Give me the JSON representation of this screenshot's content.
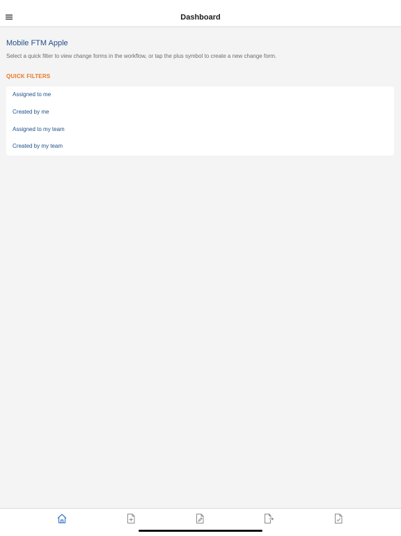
{
  "header": {
    "title": "Dashboard",
    "menu_icon": "hamburger-menu-icon"
  },
  "main": {
    "app_title": "Mobile FTM Apple",
    "subtitle": "Select a quick filter to view change forms in the workflow, or tap the plus symbol to create a new change form.",
    "section_label": "QUICK FILTERS",
    "filters": [
      {
        "label": "Assigned to me"
      },
      {
        "label": "Created by me"
      },
      {
        "label": "Assigned to my team"
      },
      {
        "label": "Created by my team"
      }
    ]
  },
  "tabbar": {
    "tabs": [
      {
        "icon": "home-icon",
        "active": true
      },
      {
        "icon": "document-add-icon",
        "active": false
      },
      {
        "icon": "document-edit-icon",
        "active": false
      },
      {
        "icon": "document-forward-icon",
        "active": false
      },
      {
        "icon": "document-check-icon",
        "active": false
      }
    ],
    "active_color": "#3a78c9",
    "inactive_color": "#8a8a8a"
  },
  "colors": {
    "accent": "#1e4e88",
    "section": "#e87722",
    "background": "#f4f4f4"
  }
}
